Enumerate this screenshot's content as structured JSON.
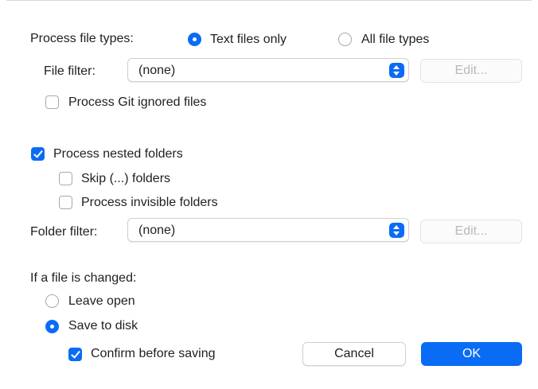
{
  "file_types": {
    "label": "Process file types:",
    "option_text": "Text files only",
    "option_all": "All file types",
    "selected": "text"
  },
  "file_filter": {
    "label": "File filter:",
    "value": "(none)",
    "edit_label": "Edit..."
  },
  "git_ignored": {
    "label": "Process Git ignored files",
    "checked": false
  },
  "nested_folders": {
    "label": "Process nested folders",
    "checked": true
  },
  "skip_folders": {
    "label": "Skip (...) folders",
    "checked": false
  },
  "invisible_folders": {
    "label": "Process invisible folders",
    "checked": false
  },
  "folder_filter": {
    "label": "Folder filter:",
    "value": "(none)",
    "edit_label": "Edit..."
  },
  "on_change": {
    "label": "If a file is changed:",
    "leave_open": "Leave open",
    "save_to_disk": "Save to disk",
    "selected": "save"
  },
  "confirm_saving": {
    "label": "Confirm before saving",
    "checked": true
  },
  "buttons": {
    "cancel": "Cancel",
    "ok": "OK"
  },
  "colors": {
    "accent": "#0a6cf5",
    "disabled_text": "#b9b9b9"
  }
}
